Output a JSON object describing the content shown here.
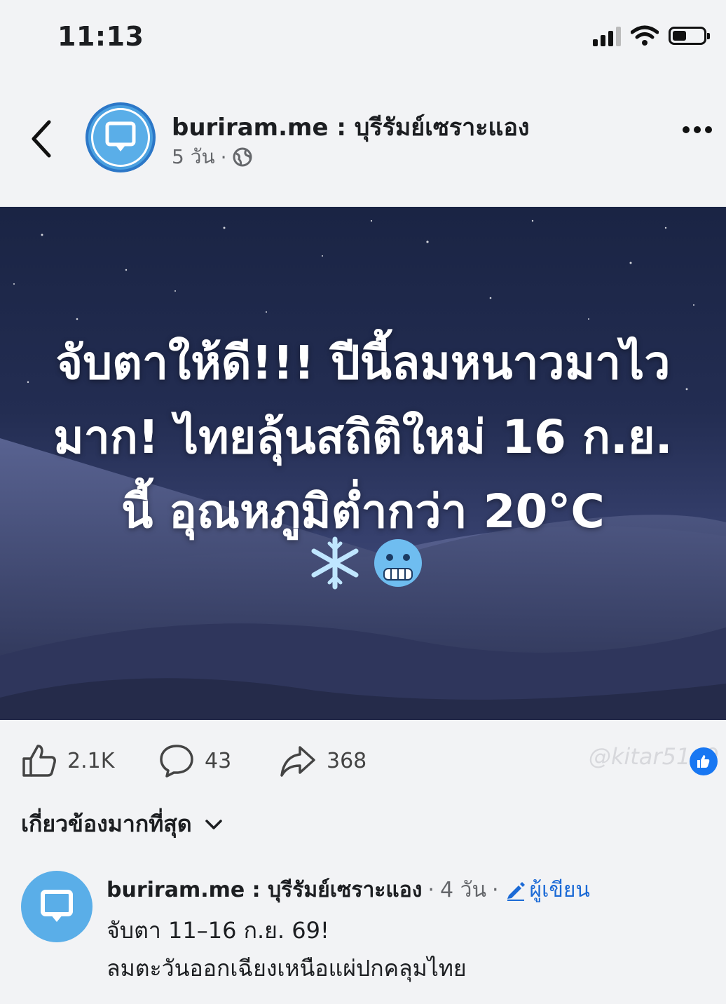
{
  "status_bar": {
    "time": "11:13",
    "battery_level": 0.45
  },
  "post": {
    "page_name": "buriram.me : บุรีรัมย์เซราะแอง",
    "time": "5 วัน",
    "separator": "·",
    "headline": "จับตาให้ดี!!! ปีนี้ลมหนาวมาไวมาก! ไทยลุ้นสถิติใหม่ 16 ก.ย. นี้ อุณหภูมิต่ำกว่า 20°C",
    "emojis": [
      "❄️",
      "🥶"
    ]
  },
  "actions": {
    "likes": "2.1K",
    "comments": "43",
    "shares": "368",
    "watermark": "@kitar5149"
  },
  "sort": {
    "label": "เกี่ยวข้องมากที่สุด"
  },
  "comment": {
    "author": "buriram.me : บุรีรัมย์เซราะแอง",
    "dot1": "·",
    "time": "4 วัน",
    "dot2": "·",
    "badge": "ผู้เขียน",
    "line1": "จับตา 11–16 ก.ย. 69!",
    "line2": "ลมตะวันออกเฉียงเหนือแผ่ปกคลุมไทย"
  },
  "icons": {
    "back": "back-chevron-icon",
    "globe": "globe-icon",
    "more": "more-dots-icon",
    "like": "thumbs-up-icon",
    "comment": "comment-bubble-icon",
    "share": "share-arrow-icon",
    "sort": "chevron-down-icon",
    "edit": "pencil-icon",
    "page_logo": "speech-bubble-logo-icon"
  }
}
